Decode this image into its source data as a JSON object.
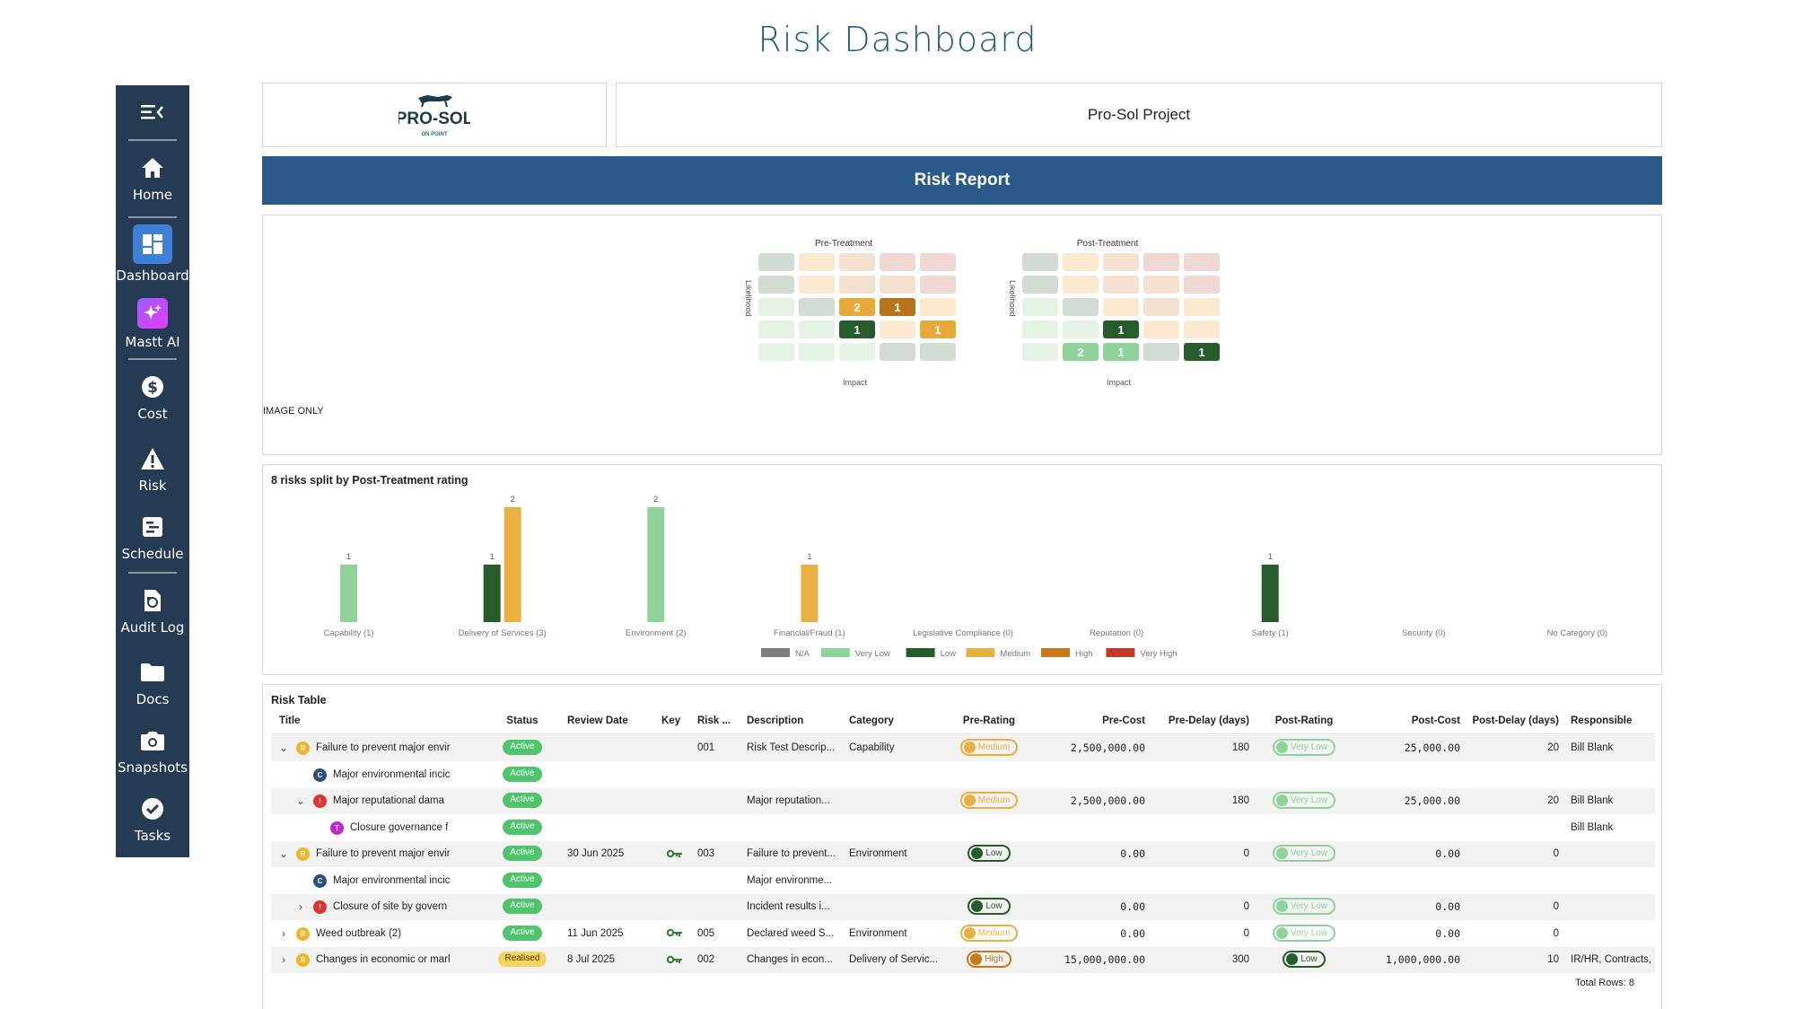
{
  "page_title": "Risk Dashboard",
  "sidebar": {
    "items": [
      {
        "label": "Home",
        "icon": "home-icon"
      },
      {
        "label": "Dashboard",
        "icon": "dashboard-icon"
      },
      {
        "label": "Mastt AI",
        "icon": "sparkle-icon"
      },
      {
        "label": "Cost",
        "icon": "dollar-icon"
      },
      {
        "label": "Risk",
        "icon": "warning-icon"
      },
      {
        "label": "Schedule",
        "icon": "schedule-icon"
      },
      {
        "label": "Audit Log",
        "icon": "audit-icon"
      },
      {
        "label": "Docs",
        "icon": "folder-icon"
      },
      {
        "label": "Snapshots",
        "icon": "camera-icon"
      },
      {
        "label": "Tasks",
        "icon": "check-icon"
      }
    ]
  },
  "logo": {
    "text": "PRO-SOL",
    "subtext": "ON POINT"
  },
  "project_name": "Pro-Sol Project",
  "report_title": "Risk Report",
  "image_only_label": "IMAGE ONLY",
  "heatmaps": [
    {
      "title": "Pre-Treatment",
      "ylabel": "Likelihood",
      "xlabel": "Impact",
      "cells": [
        [
          {
            "c": "#d3dcd3",
            "v": ""
          },
          {
            "c": "#fae9cf",
            "v": ""
          },
          {
            "c": "#f3e2cf",
            "v": ""
          },
          {
            "c": "#efd7d4",
            "v": ""
          },
          {
            "c": "#efd7d4",
            "v": ""
          }
        ],
        [
          {
            "c": "#d3dcd3",
            "v": ""
          },
          {
            "c": "#fae9cf",
            "v": ""
          },
          {
            "c": "#f3e2cf",
            "v": ""
          },
          {
            "c": "#f3e2cf",
            "v": ""
          },
          {
            "c": "#efd7d4",
            "v": ""
          }
        ],
        [
          {
            "c": "#e5f3e5",
            "v": ""
          },
          {
            "c": "#d3dcd3",
            "v": ""
          },
          {
            "c": "#e8a83a",
            "v": "2"
          },
          {
            "c": "#b8741a",
            "v": "1"
          },
          {
            "c": "#fae9cf",
            "v": ""
          }
        ],
        [
          {
            "c": "#e5f3e5",
            "v": ""
          },
          {
            "c": "#e5f3e5",
            "v": ""
          },
          {
            "c": "#255c2a",
            "v": "1"
          },
          {
            "c": "#fae9cf",
            "v": ""
          },
          {
            "c": "#e8a83a",
            "v": "1"
          }
        ],
        [
          {
            "c": "#e5f3e5",
            "v": ""
          },
          {
            "c": "#e5f3e5",
            "v": ""
          },
          {
            "c": "#e5f3e5",
            "v": ""
          },
          {
            "c": "#d3dcd3",
            "v": ""
          },
          {
            "c": "#d3dcd3",
            "v": ""
          }
        ]
      ]
    },
    {
      "title": "Post-Treatment",
      "ylabel": "Likelihood",
      "xlabel": "Impact",
      "cells": [
        [
          {
            "c": "#d3dcd3",
            "v": ""
          },
          {
            "c": "#fae9cf",
            "v": ""
          },
          {
            "c": "#f3e2cf",
            "v": ""
          },
          {
            "c": "#efd7d4",
            "v": ""
          },
          {
            "c": "#efd7d4",
            "v": ""
          }
        ],
        [
          {
            "c": "#d3dcd3",
            "v": ""
          },
          {
            "c": "#fae9cf",
            "v": ""
          },
          {
            "c": "#f3e2cf",
            "v": ""
          },
          {
            "c": "#f3e2cf",
            "v": ""
          },
          {
            "c": "#efd7d4",
            "v": ""
          }
        ],
        [
          {
            "c": "#e5f3e5",
            "v": ""
          },
          {
            "c": "#d3dcd3",
            "v": ""
          },
          {
            "c": "#fae9cf",
            "v": ""
          },
          {
            "c": "#f3e2cf",
            "v": ""
          },
          {
            "c": "#fae9cf",
            "v": ""
          }
        ],
        [
          {
            "c": "#e5f3e5",
            "v": ""
          },
          {
            "c": "#e5f3e5",
            "v": ""
          },
          {
            "c": "#255c2a",
            "v": "1"
          },
          {
            "c": "#fae9cf",
            "v": ""
          },
          {
            "c": "#fae9cf",
            "v": ""
          }
        ],
        [
          {
            "c": "#e5f3e5",
            "v": ""
          },
          {
            "c": "#8fd39a",
            "v": "2"
          },
          {
            "c": "#8fd39a",
            "v": "1"
          },
          {
            "c": "#d3dcd3",
            "v": ""
          },
          {
            "c": "#255c2a",
            "v": "1"
          }
        ]
      ]
    }
  ],
  "chart_data": {
    "type": "bar",
    "title": "8 risks split by Post-Treatment rating",
    "categories": [
      "Capability (1)",
      "Delivery of Services (3)",
      "Environment (2)",
      "Financial/Fraud (1)",
      "Legislative Compliance (0)",
      "Reputation (0)",
      "Safety (1)",
      "Security (0)",
      "No Category (0)"
    ],
    "series": [
      {
        "name": "N/A",
        "color": "#7f7f7f",
        "values": [
          0,
          0,
          0,
          0,
          0,
          0,
          0,
          0,
          0
        ]
      },
      {
        "name": "Very Low",
        "color": "#8fd39a",
        "values": [
          1,
          0,
          2,
          0,
          0,
          0,
          0,
          0,
          0
        ]
      },
      {
        "name": "Low",
        "color": "#255c2a",
        "values": [
          0,
          1,
          0,
          0,
          0,
          0,
          1,
          0,
          0
        ]
      },
      {
        "name": "Medium",
        "color": "#e8b040",
        "values": [
          0,
          2,
          0,
          1,
          0,
          0,
          0,
          0,
          0
        ]
      },
      {
        "name": "High",
        "color": "#c57a1d",
        "values": [
          0,
          0,
          0,
          0,
          0,
          0,
          0,
          0,
          0
        ]
      },
      {
        "name": "Very High",
        "color": "#c0392b",
        "values": [
          0,
          0,
          0,
          0,
          0,
          0,
          0,
          0,
          0
        ]
      }
    ],
    "ylim": [
      0,
      2
    ],
    "legend": "bottom"
  },
  "risk_table": {
    "title": "Risk Table",
    "columns": [
      "Title",
      "Status",
      "Review Date",
      "Key",
      "Risk ...",
      "Description",
      "Category",
      "Pre-Rating",
      "Pre-Cost",
      "Pre-Delay (days)",
      "Post-Rating",
      "Post-Cost",
      "Post-Delay (days)",
      "Responsible"
    ],
    "rows": [
      {
        "indent": 0,
        "chevron": "down",
        "avatar": "R",
        "avatar_color": "#f0b429",
        "title": "Failure to prevent major envir",
        "status": "Active",
        "review": "",
        "key": false,
        "risk": "001",
        "desc": "Risk Test Descrip...",
        "category": "Capability",
        "pre_rating": "Medium",
        "pre_cost": "2,500,000.00",
        "pre_delay": "180",
        "post_rating": "Very Low",
        "post_cost": "25,000.00",
        "post_delay": "20",
        "responsible": "Bill Blank"
      },
      {
        "indent": 1,
        "chevron": "",
        "avatar": "C",
        "avatar_color": "#2b4f7e",
        "title": "Major environmental incic",
        "status": "Active",
        "review": "",
        "key": false,
        "risk": "",
        "desc": "",
        "category": "",
        "pre_rating": "",
        "pre_cost": "",
        "pre_delay": "",
        "post_rating": "",
        "post_cost": "",
        "post_delay": "",
        "responsible": ""
      },
      {
        "indent": 1,
        "chevron": "down",
        "avatar": "!",
        "avatar_color": "#e0322e",
        "title": "Major reputational dama",
        "status": "Active",
        "review": "",
        "key": false,
        "risk": "",
        "desc": "Major reputation...",
        "category": "",
        "pre_rating": "Medium",
        "pre_cost": "2,500,000.00",
        "pre_delay": "180",
        "post_rating": "Very Low",
        "post_cost": "25,000.00",
        "post_delay": "20",
        "responsible": "Bill Blank"
      },
      {
        "indent": 2,
        "chevron": "",
        "avatar": "T",
        "avatar_color": "#c026d3",
        "title": "Closure governance f",
        "status": "Active",
        "review": "",
        "key": false,
        "risk": "",
        "desc": "",
        "category": "",
        "pre_rating": "",
        "pre_cost": "",
        "pre_delay": "",
        "post_rating": "",
        "post_cost": "",
        "post_delay": "",
        "responsible": "Bill Blank"
      },
      {
        "indent": 0,
        "chevron": "down",
        "avatar": "R",
        "avatar_color": "#f0b429",
        "title": "Failure to prevent major envir",
        "status": "Active",
        "review": "30 Jun 2025",
        "key": true,
        "risk": "003",
        "desc": "Failure to prevent...",
        "category": "Environment",
        "pre_rating": "Low",
        "pre_cost": "0.00",
        "pre_delay": "0",
        "post_rating": "Very Low",
        "post_cost": "0.00",
        "post_delay": "0",
        "responsible": ""
      },
      {
        "indent": 1,
        "chevron": "",
        "avatar": "C",
        "avatar_color": "#2b4f7e",
        "title": "Major environmental incic",
        "status": "Active",
        "review": "",
        "key": false,
        "risk": "",
        "desc": "Major environme...",
        "category": "",
        "pre_rating": "",
        "pre_cost": "",
        "pre_delay": "",
        "post_rating": "",
        "post_cost": "",
        "post_delay": "",
        "responsible": ""
      },
      {
        "indent": 1,
        "chevron": "right",
        "avatar": "!",
        "avatar_color": "#e0322e",
        "title": "Closure of site by govern",
        "status": "Active",
        "review": "",
        "key": false,
        "risk": "",
        "desc": "Incident results i...",
        "category": "",
        "pre_rating": "Low",
        "pre_cost": "0.00",
        "pre_delay": "0",
        "post_rating": "Very Low",
        "post_cost": "0.00",
        "post_delay": "0",
        "responsible": ""
      },
      {
        "indent": 0,
        "chevron": "right",
        "avatar": "R",
        "avatar_color": "#f0b429",
        "title": "Weed outbreak  (2)",
        "status": "Active",
        "review": "11 Jun 2025",
        "key": true,
        "risk": "005",
        "desc": "Declared weed S...",
        "category": "Environment",
        "pre_rating": "Medium",
        "pre_cost": "0.00",
        "pre_delay": "0",
        "post_rating": "Very Low",
        "post_cost": "0.00",
        "post_delay": "0",
        "responsible": ""
      },
      {
        "indent": 0,
        "chevron": "right",
        "avatar": "R",
        "avatar_color": "#f0b429",
        "title": "Changes in economic or marl",
        "status": "Realised",
        "review": "8 Jul 2025",
        "key": true,
        "risk": "002",
        "desc": "Changes in econ...",
        "category": "Delivery of Servic...",
        "pre_rating": "High",
        "pre_cost": "15,000,000.00",
        "pre_delay": "300",
        "post_rating": "Low",
        "post_cost": "1,000,000.00",
        "post_delay": "10",
        "responsible": "IR/HR, Contracts, ..."
      }
    ],
    "total_rows": "Total Rows: 8"
  },
  "rating_styles": {
    "Very Low": {
      "dot": "#8fd39a",
      "border": "#8fd39a",
      "text": "#8fd39a"
    },
    "Low": {
      "dot": "#255c2a",
      "border": "#255c2a",
      "text": "#255c2a"
    },
    "Medium": {
      "dot": "#e8b040",
      "border": "#e8b040",
      "text": "#e8b040"
    },
    "High": {
      "dot": "#c57a1d",
      "border": "#c57a1d",
      "text": "#c57a1d"
    }
  }
}
